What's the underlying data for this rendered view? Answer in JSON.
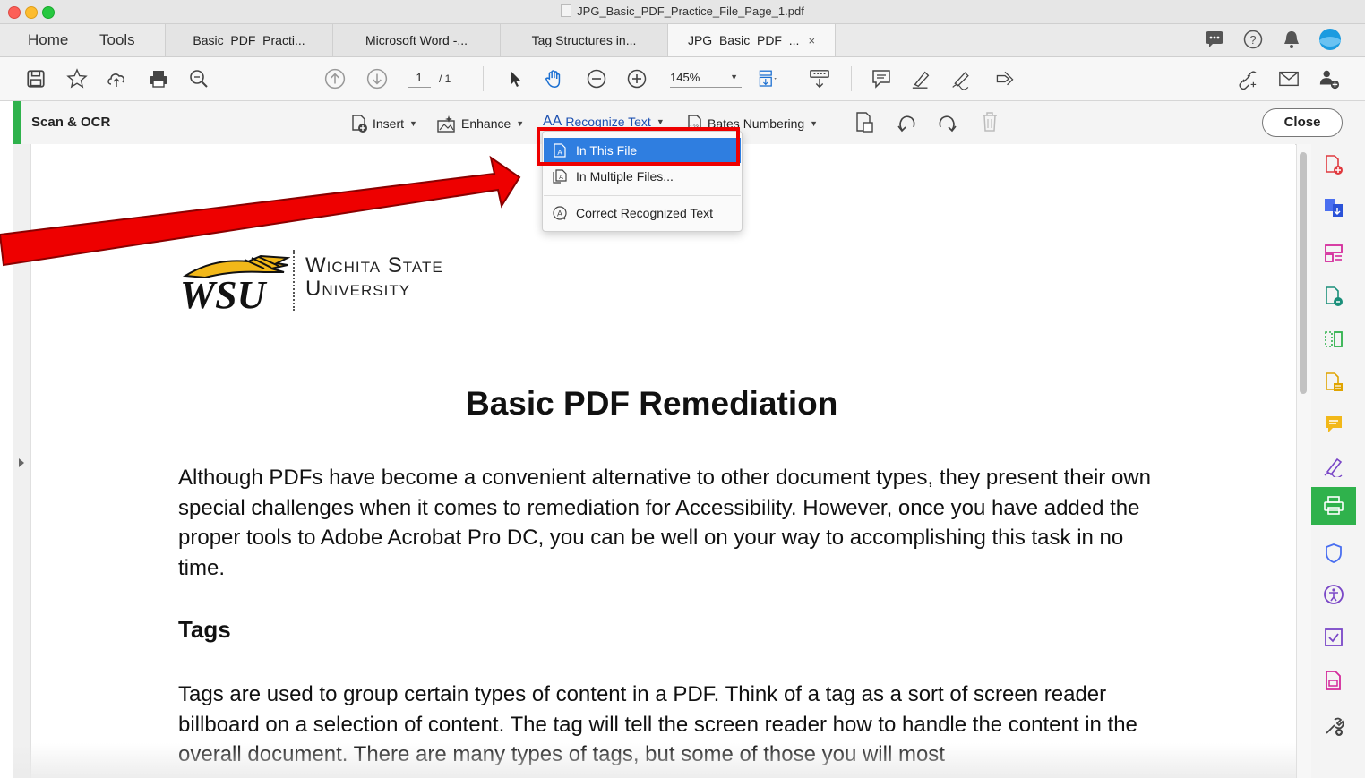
{
  "window": {
    "title": "JPG_Basic_PDF_Practice_File_Page_1.pdf"
  },
  "tabbar": {
    "home": "Home",
    "tools": "Tools",
    "tabs": [
      {
        "label": "Basic_PDF_Practi..."
      },
      {
        "label": "Microsoft Word -..."
      },
      {
        "label": "Tag Structures in..."
      },
      {
        "label": "JPG_Basic_PDF_...",
        "close": "×"
      }
    ]
  },
  "toolbar": {
    "page_current": "1",
    "page_total": "/ 1",
    "zoom": "145%"
  },
  "ocr_bar": {
    "title": "Scan & OCR",
    "insert": "Insert",
    "enhance": "Enhance",
    "recognize_text": "Recognize Text",
    "bates_numbering": "Bates Numbering",
    "close": "Close"
  },
  "menu": {
    "items": [
      {
        "label": "In This File"
      },
      {
        "label": "In Multiple Files..."
      },
      {
        "label": "Correct Recognized Text"
      }
    ]
  },
  "document": {
    "logo_monogram": "WSU",
    "logo_line1": "Wichita State",
    "logo_line2": "University",
    "title": "Basic PDF Remediation",
    "para1": "Although PDFs have become a convenient alternative to other document types, they present their own special challenges when it comes to remediation for Accessibility. However, once you have added the proper tools to Adobe Acrobat Pro DC, you can be well on your way to accomplishing this task in no time.",
    "heading_tags": "Tags",
    "para2": "Tags are used to group certain types of content in a PDF. Think of a tag as a sort of screen reader billboard on a selection of content. The tag will tell the screen reader how to handle the content in the overall document. There are many types of tags, but some of those you will most"
  },
  "colors": {
    "accent_green": "#2fb24c",
    "menu_highlight": "#2f7ee0",
    "annotation_red": "#ee0000",
    "wsu_gold": "#f2b819"
  }
}
